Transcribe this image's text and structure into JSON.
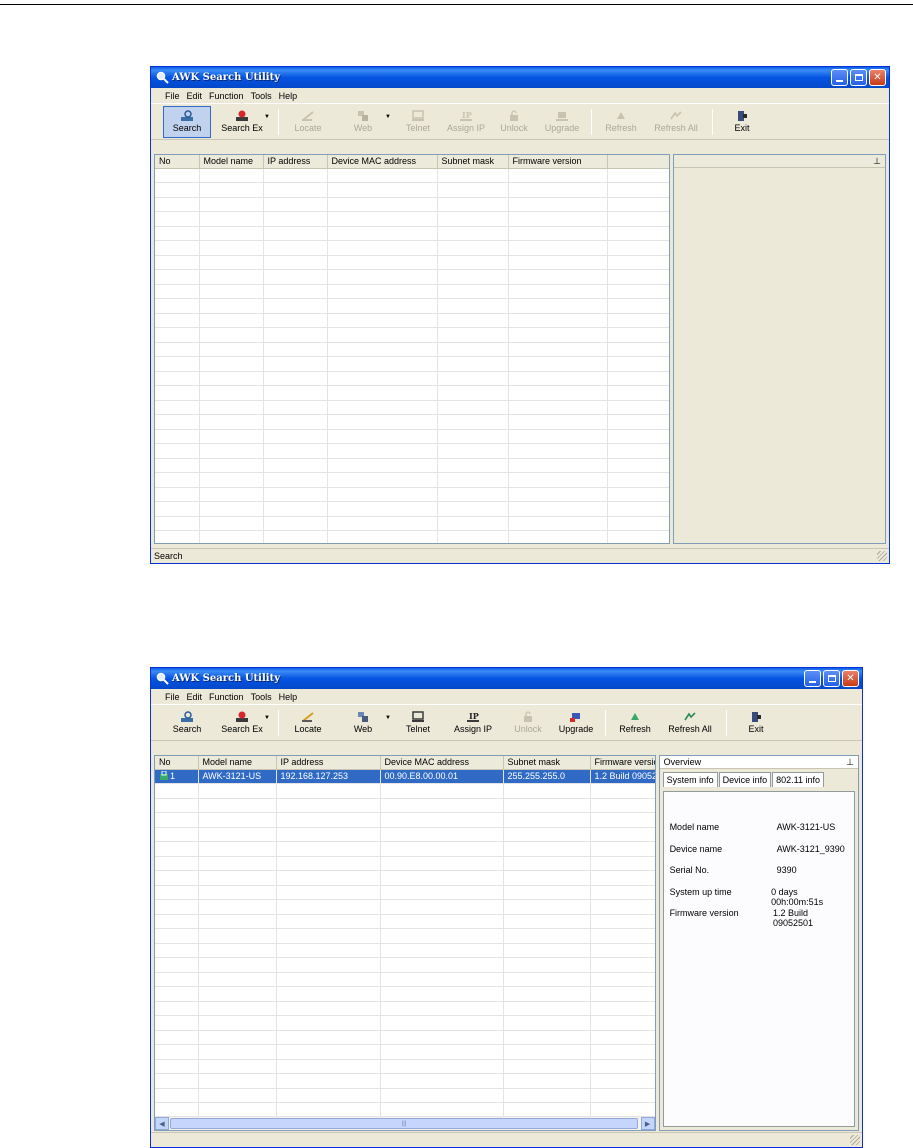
{
  "windows": [
    {
      "title": "AWK Search Utility",
      "menu": [
        "File",
        "Edit",
        "Function",
        "Tools",
        "Help"
      ],
      "toolbar": [
        {
          "label": "Search",
          "icon": "search-icon",
          "state": "active"
        },
        {
          "label": "Search Ex",
          "icon": "search-ex-icon",
          "state": "enabled",
          "dropdown": true
        },
        {
          "label": "Locate",
          "icon": "locate-icon",
          "state": "disabled"
        },
        {
          "label": "Web",
          "icon": "web-icon",
          "state": "disabled",
          "dropdown": true
        },
        {
          "label": "Telnet",
          "icon": "telnet-icon",
          "state": "disabled"
        },
        {
          "label": "Assign IP",
          "icon": "assign-ip-icon",
          "state": "disabled"
        },
        {
          "label": "Unlock",
          "icon": "unlock-icon",
          "state": "disabled"
        },
        {
          "label": "Upgrade",
          "icon": "upgrade-icon",
          "state": "disabled"
        },
        {
          "label": "Refresh",
          "icon": "refresh-icon",
          "state": "disabled"
        },
        {
          "label": "Refresh All",
          "icon": "refresh-all-icon",
          "state": "disabled"
        },
        {
          "label": "Exit",
          "icon": "exit-icon",
          "state": "enabled"
        }
      ],
      "columns": [
        "No",
        "Model name",
        "IP address",
        "Device MAC address",
        "Subnet mask",
        "Firmware version"
      ],
      "rows": [],
      "status": "Search"
    },
    {
      "title": "AWK Search Utility",
      "menu": [
        "File",
        "Edit",
        "Function",
        "Tools",
        "Help"
      ],
      "toolbar": [
        {
          "label": "Search",
          "icon": "search-icon",
          "state": "enabled"
        },
        {
          "label": "Search Ex",
          "icon": "search-ex-icon",
          "state": "enabled",
          "dropdown": true
        },
        {
          "label": "Locate",
          "icon": "locate-icon",
          "state": "enabled"
        },
        {
          "label": "Web",
          "icon": "web-icon",
          "state": "enabled",
          "dropdown": true
        },
        {
          "label": "Telnet",
          "icon": "telnet-icon",
          "state": "enabled"
        },
        {
          "label": "Assign IP",
          "icon": "assign-ip-icon",
          "state": "enabled"
        },
        {
          "label": "Unlock",
          "icon": "unlock-icon",
          "state": "disabled"
        },
        {
          "label": "Upgrade",
          "icon": "upgrade-icon",
          "state": "enabled"
        },
        {
          "label": "Refresh",
          "icon": "refresh-icon",
          "state": "enabled"
        },
        {
          "label": "Refresh All",
          "icon": "refresh-all-icon",
          "state": "enabled"
        },
        {
          "label": "Exit",
          "icon": "exit-icon",
          "state": "enabled"
        }
      ],
      "columns": [
        "No",
        "Model name",
        "IP address",
        "Device MAC address",
        "Subnet mask",
        "Firmware versio"
      ],
      "rows": [
        [
          "1",
          "AWK-3121-US",
          "192.168.127.253",
          "00.90.E8.00.00.01",
          "255.255.255.0",
          "1.2 Build 09052"
        ]
      ],
      "panel": {
        "header": "Overview",
        "tabs": [
          "System info",
          "Device info",
          "802.11 info"
        ],
        "info": [
          {
            "key": "Model name",
            "value": "AWK-3121-US"
          },
          {
            "key": "Device name",
            "value": "AWK-3121_9390"
          },
          {
            "key": "Serial No.",
            "value": "9390"
          },
          {
            "key": "System up time",
            "value": "0 days 00h:00m:51s"
          },
          {
            "key": "Firmware version",
            "value": "1.2 Build 09052501"
          }
        ]
      },
      "status": ""
    }
  ],
  "colors": {
    "title_bar": "#0554e3",
    "selection": "#316ac5",
    "window_face": "#ece9d8"
  }
}
